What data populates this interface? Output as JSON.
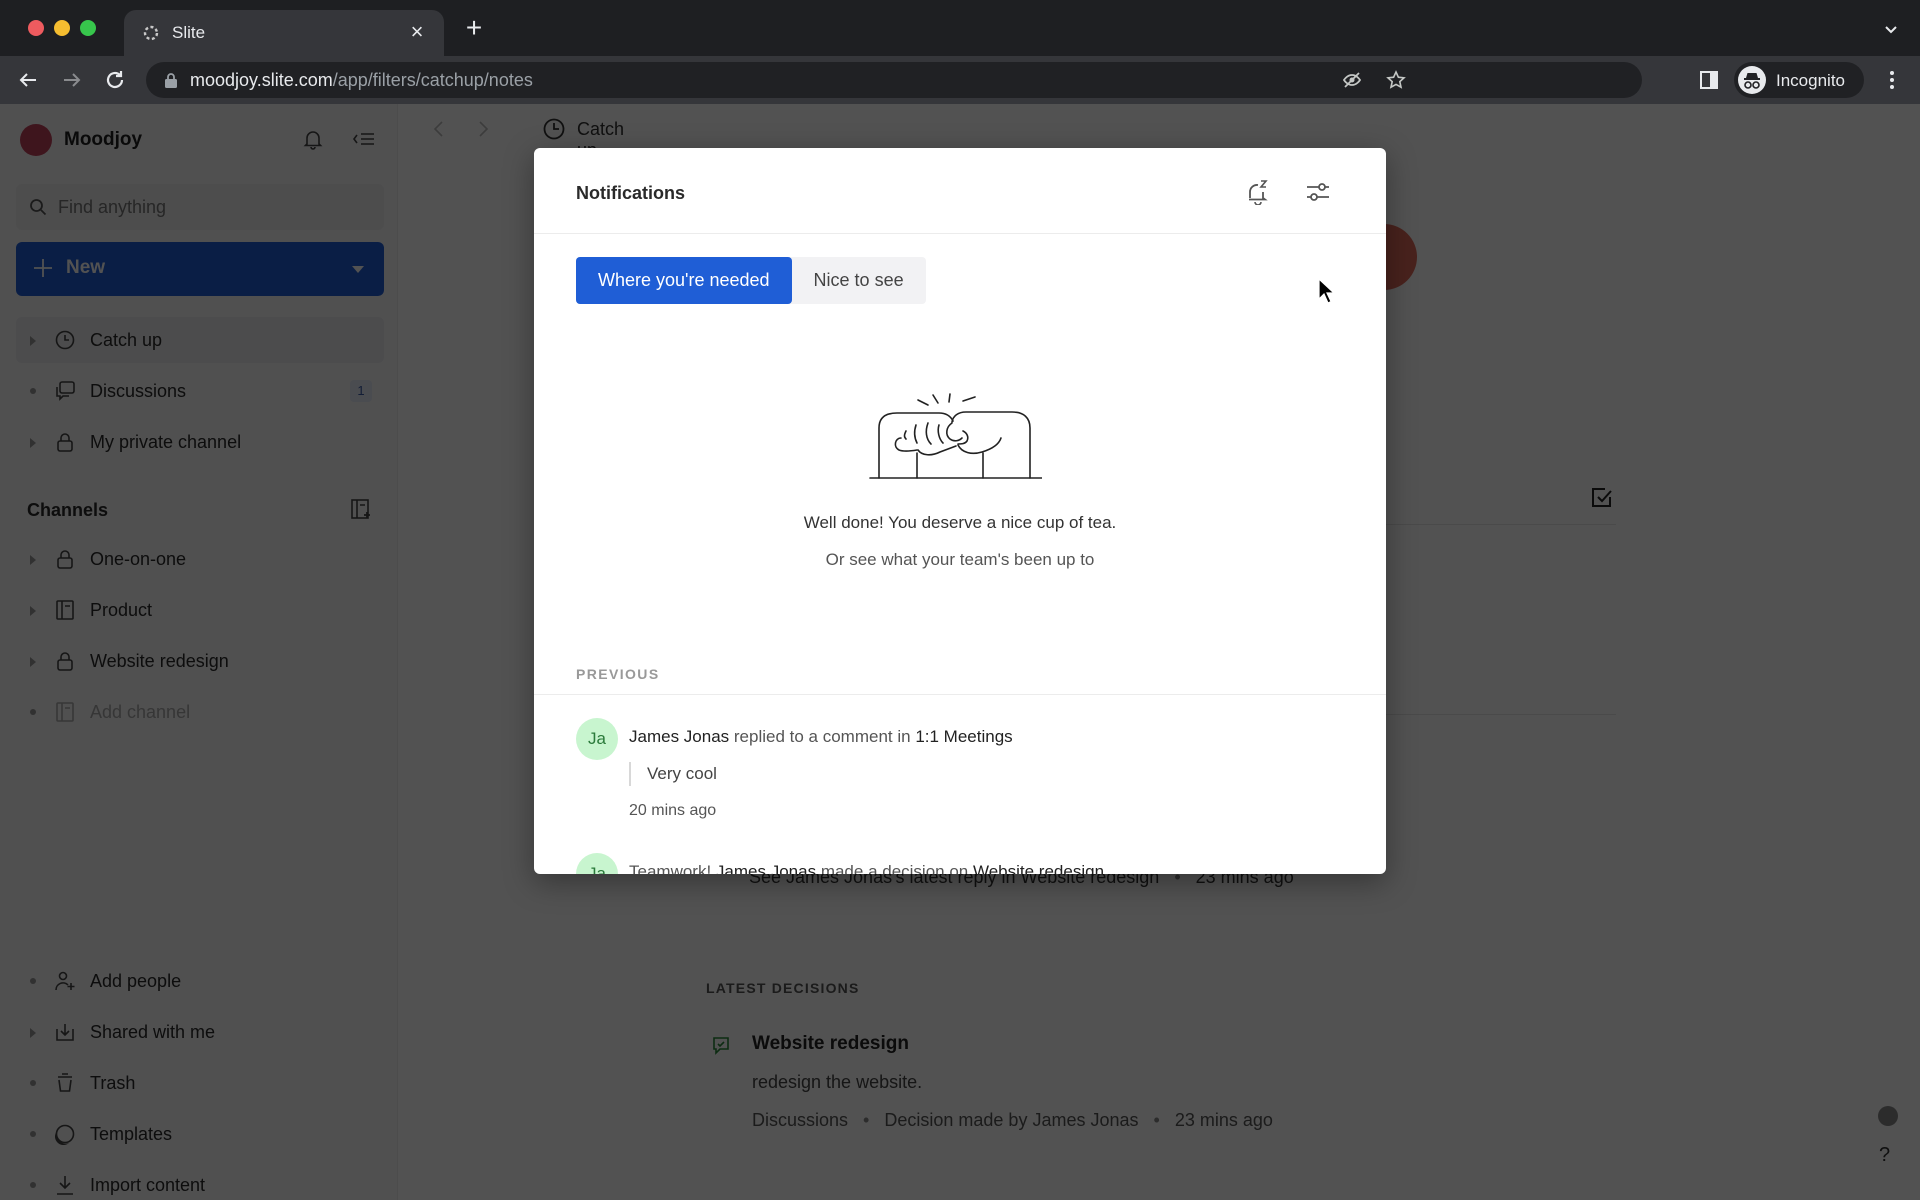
{
  "browser": {
    "tab_title": "Slite",
    "url_host": "moodjoy.slite.com",
    "url_path": "/app/filters/catchup/notes",
    "profile_label": "Incognito",
    "icons": [
      "slite-favicon-icon",
      "close-icon",
      "plus-icon",
      "chevron-down-icon",
      "back-arrow-icon",
      "forward-arrow-icon",
      "reload-icon",
      "lock-icon",
      "eye-off-icon",
      "star-icon",
      "side-panel-icon",
      "incognito-icon",
      "kebab-menu-icon"
    ]
  },
  "sidebar": {
    "workspace_name": "Moodjoy",
    "search_placeholder": "Find anything",
    "new_button_label": "New",
    "primary_items": [
      {
        "label": "Catch up",
        "icon": "clock-icon",
        "active": true
      },
      {
        "label": "Discussions",
        "icon": "chat-icon",
        "badge": "1"
      },
      {
        "label": "My private channel",
        "icon": "lock-icon"
      }
    ],
    "channels_title": "Channels",
    "channels": [
      {
        "label": "One-on-one",
        "icon": "lock-icon"
      },
      {
        "label": "Product",
        "icon": "notebook-icon"
      },
      {
        "label": "Website redesign",
        "icon": "lock-icon"
      },
      {
        "label": "Add channel",
        "icon": "add-channel-icon",
        "muted": true
      }
    ],
    "footer_items": [
      {
        "label": "Add people",
        "icon": "add-person-icon"
      },
      {
        "label": "Shared with me",
        "icon": "inbox-download-icon"
      },
      {
        "label": "Trash",
        "icon": "trash-icon"
      },
      {
        "label": "Templates",
        "icon": "templates-icon"
      },
      {
        "label": "Import content",
        "icon": "import-icon"
      }
    ]
  },
  "main": {
    "breadcrumb_label": "Catch up",
    "latest_reply": {
      "text": "See James Jonas's latest reply in Website redesign",
      "time": "23 mins ago"
    },
    "latest_decisions_title": "LATEST DECISIONS",
    "decision": {
      "title": "Website redesign",
      "body": "redesign the website.",
      "channel": "Discussions",
      "made_by": "Decision made by James Jonas",
      "time": "23 mins ago"
    },
    "help_label": "?"
  },
  "modal": {
    "title": "Notifications",
    "tabs": [
      {
        "label": "Where you're needed",
        "active": true
      },
      {
        "label": "Nice to see",
        "active": false
      }
    ],
    "empty_title": "Well done! You deserve a nice cup of tea.",
    "empty_subtitle": "Or see what your team's been up to",
    "previous_label": "PREVIOUS",
    "notifications": [
      {
        "avatar": "Ja",
        "actor": "James Jonas",
        "action": " replied to a comment in ",
        "target": "1:1 Meetings",
        "quote": "Very cool",
        "time": "20 mins ago"
      },
      {
        "avatar": "Ja",
        "prefix": "Teamwork! ",
        "actor": "James Jonas",
        "action": " made a decision on ",
        "target": "Website redesign"
      }
    ]
  },
  "colors": {
    "accent": "#1f5ed6",
    "avatar_bg": "#c8f5cf",
    "workspace_logo": "#c2415a"
  }
}
